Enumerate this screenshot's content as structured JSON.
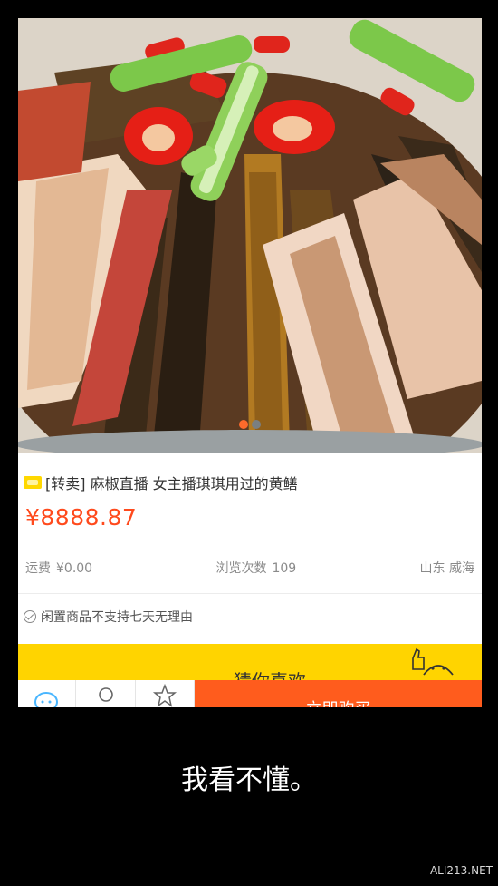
{
  "product": {
    "title": "[转卖] 麻椒直播  女主播琪琪用过的黄鳝",
    "price": "¥8888.87",
    "shipping_label": "运费",
    "shipping_value": "¥0.00",
    "views_label": "浏览次数",
    "views_value": "109",
    "location": "山东 威海",
    "notice": "闲置商品不支持七天无理由"
  },
  "carousel": {
    "count": 2,
    "active_index": 0
  },
  "banner": {
    "guess_title": "猜你喜欢"
  },
  "bottom_bar": {
    "buy_label": "立即购买"
  },
  "caption": "我看不懂。",
  "watermark": "ALI213.NET",
  "colors": {
    "price": "#ff4a1d",
    "banner": "#ffd400",
    "buy": "#ff5c1d"
  }
}
